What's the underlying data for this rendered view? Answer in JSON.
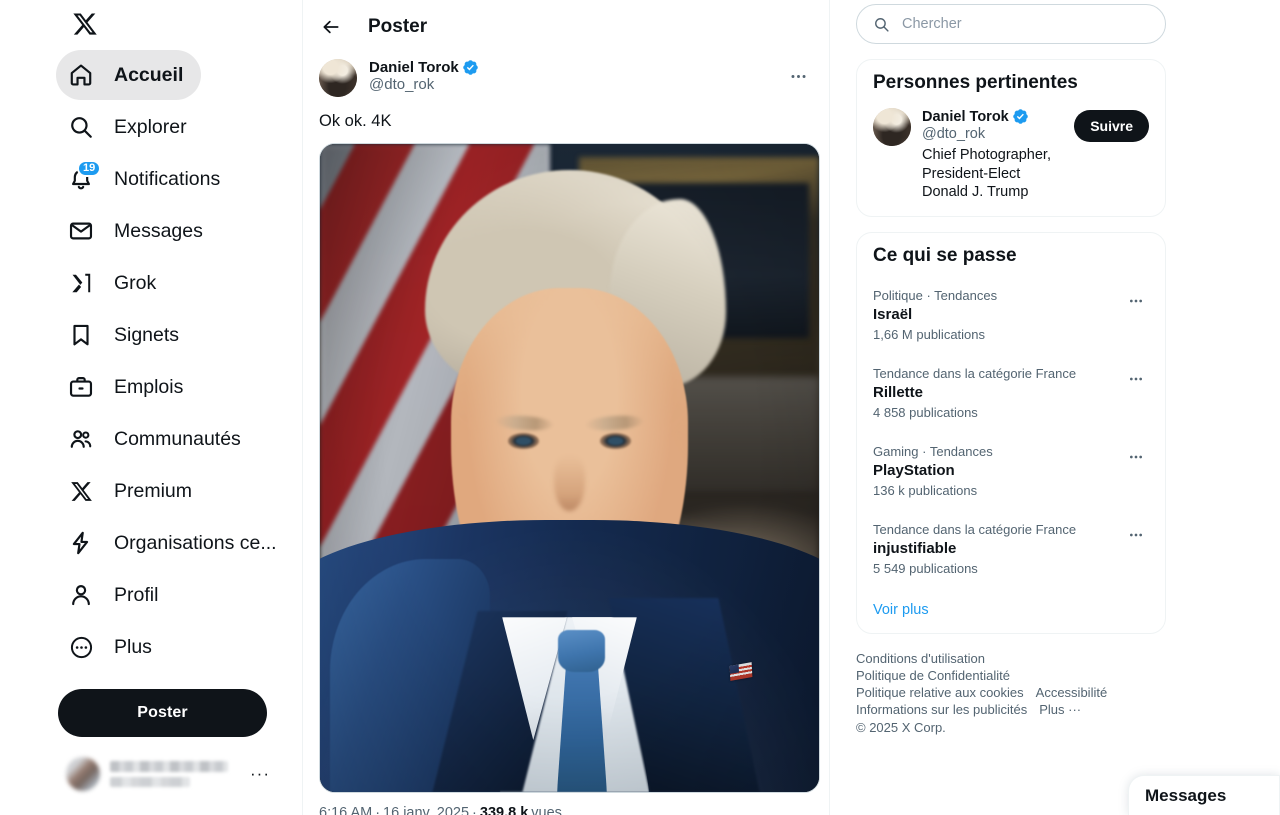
{
  "sidebar": {
    "logo": "x-logo",
    "items": [
      {
        "label": "Accueil",
        "icon": "home-icon",
        "active": true,
        "badge": null
      },
      {
        "label": "Explorer",
        "icon": "search-icon",
        "active": false,
        "badge": null
      },
      {
        "label": "Notifications",
        "icon": "bell-icon",
        "active": false,
        "badge": "19"
      },
      {
        "label": "Messages",
        "icon": "envelope-icon",
        "active": false,
        "badge": null
      },
      {
        "label": "Grok",
        "icon": "grok-icon",
        "active": false,
        "badge": null
      },
      {
        "label": "Signets",
        "icon": "bookmark-icon",
        "active": false,
        "badge": null
      },
      {
        "label": "Emplois",
        "icon": "briefcase-icon",
        "active": false,
        "badge": null
      },
      {
        "label": "Communautés",
        "icon": "communities-icon",
        "active": false,
        "badge": null
      },
      {
        "label": "Premium",
        "icon": "x-premium-icon",
        "active": false,
        "badge": null
      },
      {
        "label": "Organisations ce...",
        "icon": "lightning-icon",
        "active": false,
        "badge": null
      },
      {
        "label": "Profil",
        "icon": "person-icon",
        "active": false,
        "badge": null
      },
      {
        "label": "Plus",
        "icon": "more-circle-icon",
        "active": false,
        "badge": null
      }
    ],
    "post_button": "Poster",
    "account_more": "···"
  },
  "center": {
    "back_icon": "arrow-left-icon",
    "header_title": "Poster",
    "tweet": {
      "author_name": "Daniel Torok",
      "author_handle": "@dto_rok",
      "verified": true,
      "more_icon": "more-horizontal-icon",
      "text": "Ok ok. 4K",
      "image_alt": "Portrait de Donald Trump devant un drapeau américain",
      "meta_time": "6:16 AM",
      "meta_sep1": "·",
      "meta_date": "16 janv. 2025",
      "meta_sep2": "·",
      "meta_views_count": "339,8 k",
      "meta_views_label": "vues"
    }
  },
  "right": {
    "search": {
      "placeholder": "Chercher",
      "value": "",
      "icon": "search-icon"
    },
    "people_card": {
      "title": "Personnes pertinentes",
      "person": {
        "name": "Daniel Torok",
        "handle": "@dto_rok",
        "verified": true,
        "bio": "Chief Photographer, President-Elect Donald J. Trump",
        "follow_label": "Suivre"
      }
    },
    "trends_card": {
      "title": "Ce qui se passe",
      "items": [
        {
          "category": "Politique · Tendances",
          "name": "Israël",
          "count": "1,66 M publications"
        },
        {
          "category": "Tendance dans la catégorie France",
          "name": "Rillette",
          "count": "4 858 publications"
        },
        {
          "category": "Gaming · Tendances",
          "name": "PlayStation",
          "count": "136 k publications"
        },
        {
          "category": "Tendance dans la catégorie France",
          "name": "injustifiable",
          "count": "5 549 publications"
        }
      ],
      "show_more": "Voir plus",
      "item_more_icon": "more-horizontal-icon"
    },
    "footer": {
      "links_row1": [
        "Conditions d'utilisation"
      ],
      "links_row2": [
        "Politique de Confidentialité"
      ],
      "links_row3": [
        "Politique relative aux cookies",
        "Accessibilité"
      ],
      "links_row4": [
        "Informations sur les publicités",
        "Plus ···"
      ],
      "copyright": "© 2025 X Corp."
    }
  },
  "dock": {
    "messages_title": "Messages"
  },
  "colors": {
    "accent_blue": "#1d9bf0",
    "text_primary": "#0f1419",
    "text_secondary": "#536471",
    "border": "#eff3f4",
    "button_dark": "#0f1419",
    "hover_grey": "#e7e7e8"
  }
}
